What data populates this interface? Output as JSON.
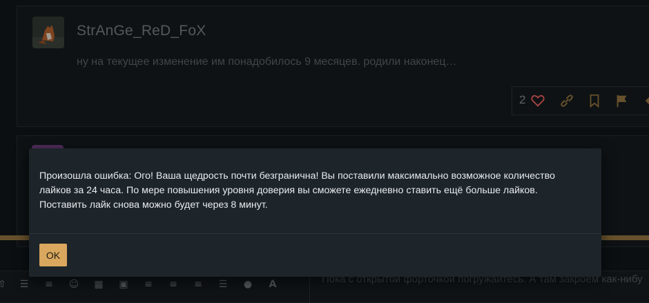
{
  "post": {
    "username": "StrAnGe_ReD_FoX",
    "text": "ну на текущее изменение им понадобилось 9 месяцев. родили наконец…",
    "like_count": "2",
    "icons": [
      "heart-icon",
      "link-icon",
      "bookmark-icon",
      "flag-icon",
      "reply-icon"
    ]
  },
  "editor": {
    "text": "Пока с открытой форточкой погружайтесь. А там закроем как-нибу",
    "toolbar_icons": [
      "upload-icon",
      "bullet-list-icon",
      "numbered-list-icon",
      "emoji-icon",
      "calendar-icon",
      "image-icon",
      "align-left-icon",
      "align-center-icon",
      "align-right-icon",
      "align-justify-icon",
      "palette-icon",
      "font-icon"
    ]
  },
  "dialog": {
    "message": "Произошла ошибка: Ого! Ваша щедрость почти безгранична! Вы поставили максимально возможное количество лайков за 24 часа. По мере повышения уровня доверия вы сможете ежедневно ставить ещё больше лайков. Поставить лайк снова можно будет через 8 минут.",
    "ok_label": "OK"
  },
  "colors": {
    "accent": "#d9a75d",
    "background": "#0f1417",
    "dialog_bg": "#1d242a",
    "heart": "#e45b5b"
  }
}
